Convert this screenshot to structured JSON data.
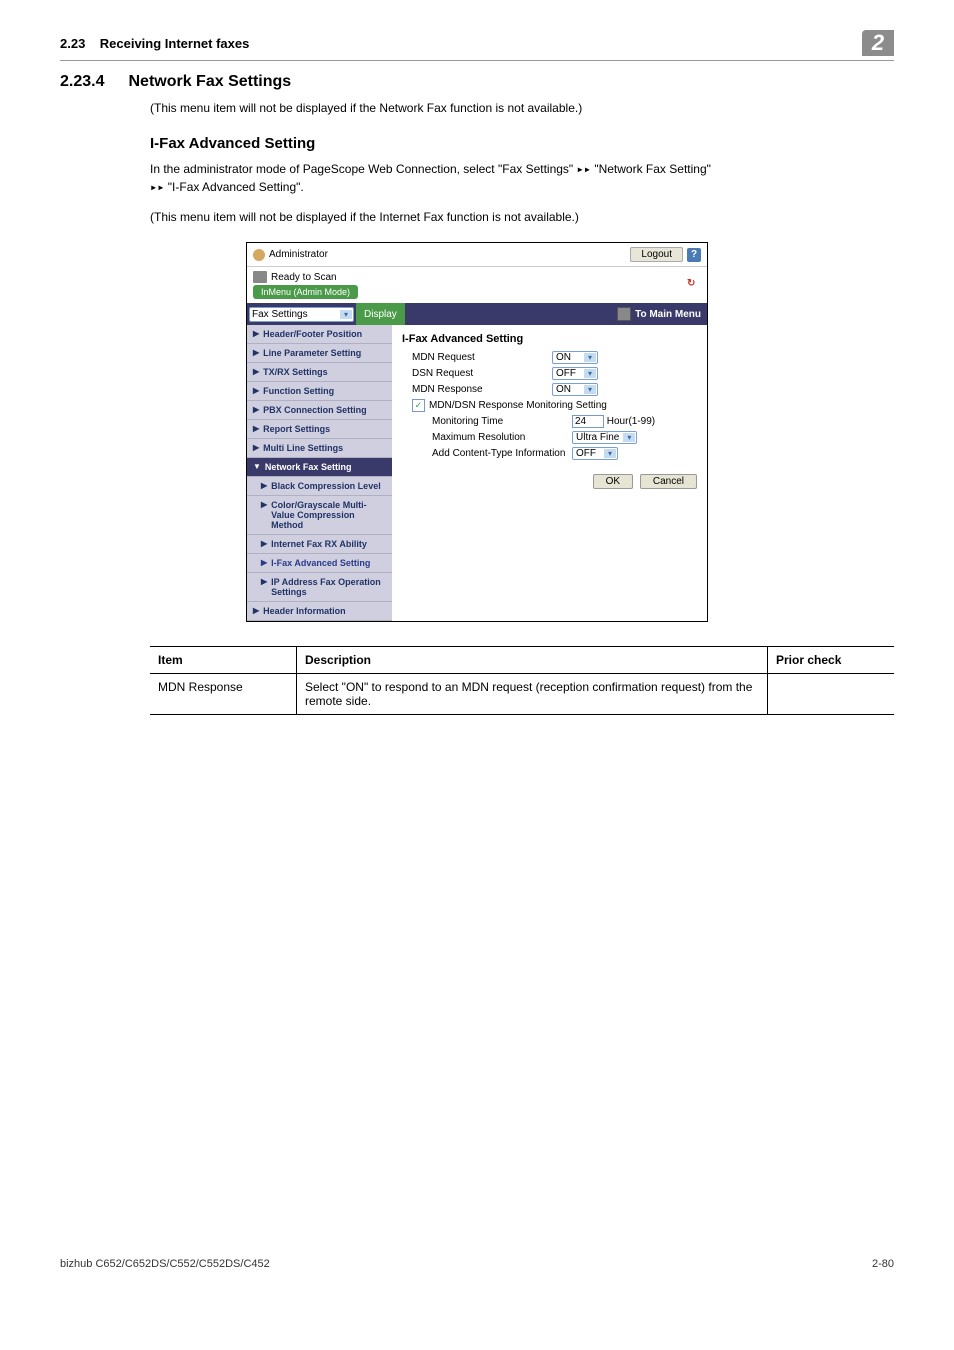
{
  "header": {
    "section_ref": "2.23",
    "section_title_top": "Receiving Internet faxes",
    "chapter_badge": "2"
  },
  "section": {
    "number": "2.23.4",
    "title": "Network Fax Settings",
    "intro": "(This menu item will not be displayed if the Network Fax function is not available.)"
  },
  "subsection": {
    "title": "I-Fax Advanced Setting",
    "para1_a": "In the administrator mode of PageScope Web Connection, select \"Fax Settings\" ",
    "para1_b": " \"Network Fax Setting\" ",
    "para1_c": " \"I-Fax Advanced Setting\".",
    "para2": "(This menu item will not be displayed if the Internet Fax function is not available.)"
  },
  "shot": {
    "administrator": "Administrator",
    "logout": "Logout",
    "ready": "Ready to Scan",
    "menu_mode": "InMenu (Admin Mode)",
    "dropdown": "Fax Settings",
    "display_btn": "Display",
    "to_main": "To Main Menu",
    "side": {
      "items": [
        {
          "label": "Header/Footer Position",
          "tri": "▶"
        },
        {
          "label": "Line Parameter Setting",
          "tri": "▶"
        },
        {
          "label": "TX/RX Settings",
          "tri": "▶"
        },
        {
          "label": "Function Setting",
          "tri": "▶"
        },
        {
          "label": "PBX Connection Setting",
          "tri": "▶"
        },
        {
          "label": "Report Settings",
          "tri": "▶"
        },
        {
          "label": "Multi Line Settings",
          "tri": "▶"
        },
        {
          "label": "Network Fax Setting",
          "tri": "▼",
          "dark": true
        },
        {
          "label": "Black Compression Level",
          "tri": "▶",
          "sub": true
        },
        {
          "label": "Color/Grayscale Multi-Value Compression Method",
          "tri": "▶",
          "sub": true
        },
        {
          "label": "Internet Fax RX Ability",
          "tri": "▶",
          "sub": true
        },
        {
          "label": "I-Fax Advanced Setting",
          "tri": "▶",
          "sub": true,
          "active": true
        },
        {
          "label": "IP Address Fax Operation Settings",
          "tri": "▶",
          "sub": true
        },
        {
          "label": "Header Information",
          "tri": "▶"
        }
      ]
    },
    "content": {
      "heading": "I-Fax Advanced Setting",
      "rows": [
        {
          "label": "MDN Request",
          "type": "select",
          "value": "ON"
        },
        {
          "label": "DSN Request",
          "type": "select",
          "value": "OFF"
        },
        {
          "label": "MDN Response",
          "type": "select",
          "value": "ON"
        }
      ],
      "checkbox_label": "MDN/DSN Response Monitoring Setting",
      "rows2": [
        {
          "label": "Monitoring Time",
          "type": "text",
          "value": "24",
          "suffix": "Hour(1-99)"
        },
        {
          "label": "Maximum Resolution",
          "type": "select",
          "value": "Ultra Fine"
        },
        {
          "label": "Add Content-Type Information",
          "type": "select",
          "value": "OFF"
        }
      ],
      "ok": "OK",
      "cancel": "Cancel"
    }
  },
  "table": {
    "headers": [
      "Item",
      "Description",
      "Prior check"
    ],
    "rows": [
      {
        "item": "MDN Response",
        "desc": "Select \"ON\" to respond to an MDN request (reception confirmation request) from the remote side.",
        "prior": ""
      }
    ]
  },
  "footer": {
    "left": "bizhub C652/C652DS/C552/C552DS/C452",
    "right": "2-80"
  },
  "glyphs": {
    "arrow": "▸▸",
    "help": "?",
    "check": "✓",
    "chev": "▾",
    "refresh": "↻"
  }
}
